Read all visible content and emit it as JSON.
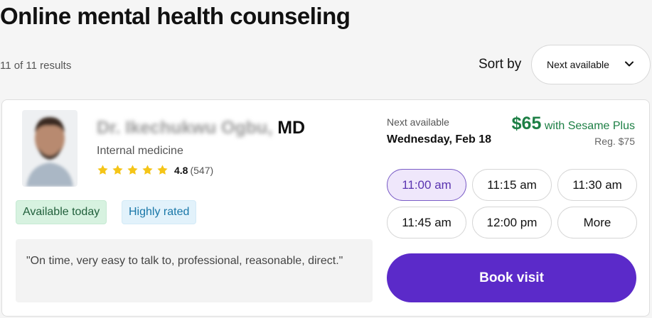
{
  "page": {
    "title": "Online mental health counseling",
    "results_count": "11 of 11 results"
  },
  "sort": {
    "label": "Sort by",
    "selected": "Next available",
    "icon": "chevron-down-icon"
  },
  "provider": {
    "name_blurred": "Dr. Ikechukwu Ogbu,",
    "credential": "MD",
    "specialty": "Internal medicine",
    "rating_value": "4.8",
    "rating_count": "(547)",
    "stars": 5,
    "badges": {
      "available": "Available today",
      "rated": "Highly rated"
    },
    "review": "\"On time, very easy to talk to, professional, reasonable, direct.\""
  },
  "availability": {
    "label": "Next available",
    "date": "Wednesday, Feb 18",
    "price": "$65",
    "price_suffix": "with Sesame Plus",
    "regular_price": "Reg. $75",
    "slots": [
      "11:00 am",
      "11:15 am",
      "11:30 am",
      "11:45 am",
      "12:00 pm",
      "More"
    ],
    "selected_slot": 0,
    "book_label": "Book visit"
  },
  "colors": {
    "accent": "#5b2ac9",
    "price_green": "#1d7f45",
    "star": "#f5c518",
    "selected_slot_bg": "#efe7fb"
  }
}
